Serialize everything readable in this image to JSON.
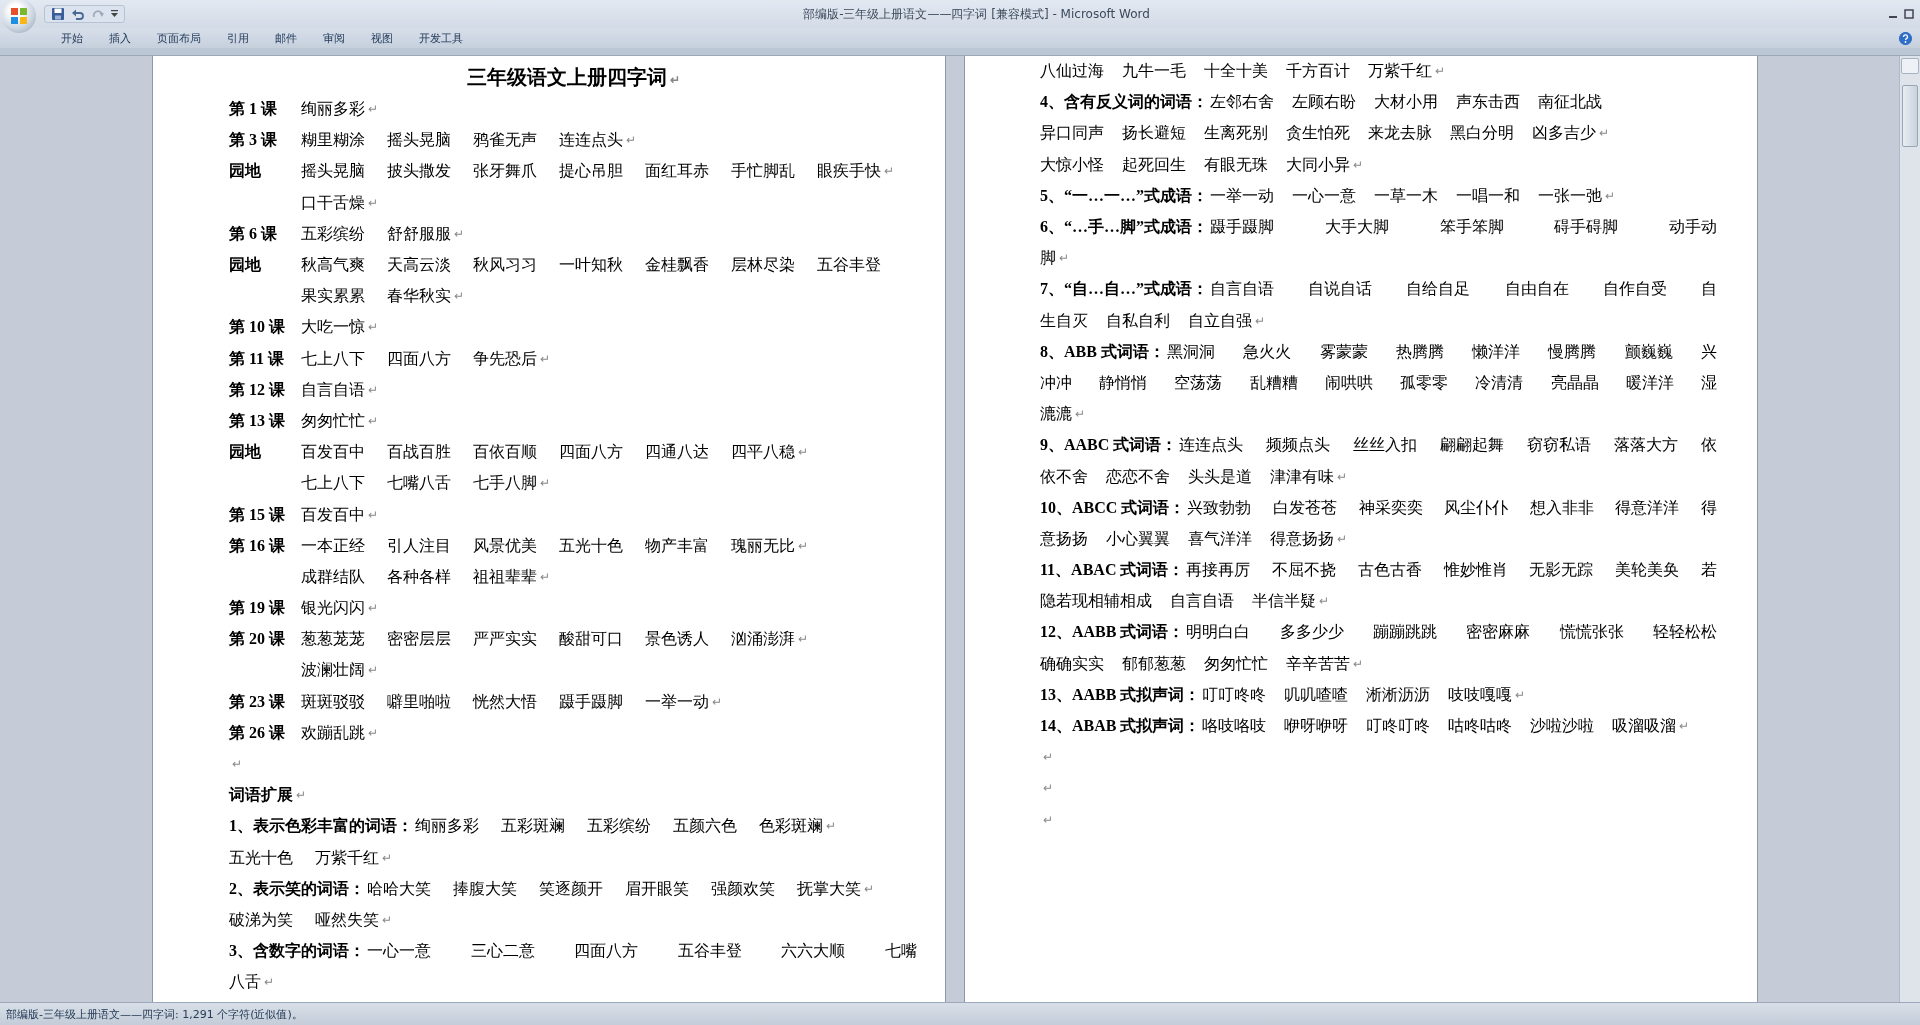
{
  "window": {
    "title": "部编版-三年级上册语文——四字词 [兼容模式] - Microsoft Word"
  },
  "ribbon_tabs": [
    {
      "label": "开始"
    },
    {
      "label": "插入"
    },
    {
      "label": "页面布局"
    },
    {
      "label": "引用"
    },
    {
      "label": "邮件"
    },
    {
      "label": "审阅"
    },
    {
      "label": "视图"
    },
    {
      "label": "开发工具"
    }
  ],
  "left_page": {
    "title": "三年级语文上册四字词",
    "end": "↵",
    "lines": [
      {
        "kind": "lesson",
        "label": "第 1 课",
        "words": [
          "绚丽多彩"
        ],
        "end": "↵"
      },
      {
        "kind": "lesson",
        "label": "第 3 课",
        "words": [
          "糊里糊涂",
          "摇头晃脑",
          "鸦雀无声",
          "连连点头"
        ],
        "end": "↵"
      },
      {
        "kind": "lesson",
        "label": "园地",
        "words": [
          "摇头晃脑",
          "披头撒发",
          "张牙舞爪",
          "提心吊胆",
          "面红耳赤",
          "手忙脚乱",
          "眼疾手快"
        ],
        "end": "↵"
      },
      {
        "kind": "continuation",
        "words": [
          "口干舌燥"
        ],
        "end": "↵"
      },
      {
        "kind": "lesson",
        "label": "第 6 课",
        "words": [
          "五彩缤纷",
          "舒舒服服"
        ],
        "end": "↵"
      },
      {
        "kind": "lesson",
        "label": "园地",
        "words": [
          "秋高气爽",
          "天高云淡",
          "秋风习习",
          "一叶知秋",
          "金桂飘香",
          "层林尽染",
          "五谷丰登"
        ]
      },
      {
        "kind": "continuation",
        "words": [
          "果实累累",
          "春华秋实"
        ],
        "end": "↵"
      },
      {
        "kind": "lesson",
        "label": "第 10 课",
        "words": [
          "大吃一惊"
        ],
        "end": "↵"
      },
      {
        "kind": "lesson",
        "label": "第 11 课",
        "words": [
          "七上八下",
          "四面八方",
          "争先恐后"
        ],
        "end": "↵"
      },
      {
        "kind": "lesson",
        "label": "第 12 课",
        "words": [
          "自言自语"
        ],
        "end": "↵"
      },
      {
        "kind": "lesson",
        "label": "第 13 课",
        "words": [
          "匆匆忙忙"
        ],
        "end": "↵"
      },
      {
        "kind": "lesson",
        "label": "园地",
        "words": [
          "百发百中",
          "百战百胜",
          "百依百顺",
          "四面八方",
          "四通八达",
          "四平八稳"
        ],
        "end": "↵"
      },
      {
        "kind": "continuation",
        "words": [
          "七上八下",
          "七嘴八舌",
          "七手八脚"
        ],
        "end": "↵"
      },
      {
        "kind": "lesson",
        "label": "第 15 课",
        "words": [
          "百发百中"
        ],
        "end": "↵"
      },
      {
        "kind": "lesson",
        "label": "第 16 课",
        "words": [
          "一本正经",
          "引人注目",
          "风景优美",
          "五光十色",
          "物产丰富",
          "瑰丽无比"
        ],
        "end": "↵"
      },
      {
        "kind": "continuation",
        "words": [
          "成群结队",
          "各种各样",
          "祖祖辈辈"
        ],
        "end": "↵"
      },
      {
        "kind": "lesson",
        "label": "第 19 课",
        "words": [
          "银光闪闪"
        ],
        "end": "↵"
      },
      {
        "kind": "lesson",
        "label": "第 20 课",
        "words": [
          "葱葱茏茏",
          "密密层层",
          "严严实实",
          "酸甜可口",
          "景色诱人",
          "汹涌澎湃"
        ],
        "end": "↵"
      },
      {
        "kind": "continuation",
        "words": [
          "波澜壮阔"
        ],
        "end": "↵"
      },
      {
        "kind": "lesson",
        "label": "第 23 课",
        "words": [
          "斑斑驳驳",
          "噼里啪啦",
          "恍然大悟",
          "蹑手蹑脚",
          "一举一动"
        ],
        "end": "↵"
      },
      {
        "kind": "lesson",
        "label": "第 26 课",
        "words": [
          "欢蹦乱跳"
        ],
        "end": "↵"
      },
      {
        "kind": "blank",
        "end": "↵"
      },
      {
        "kind": "heading",
        "label": "词语扩展",
        "end": "↵"
      },
      {
        "kind": "item",
        "label": "1、表示色彩丰富的词语：",
        "words": [
          "绚丽多彩",
          "五彩斑斓",
          "五彩缤纷",
          "五颜六色",
          "色彩斑斓"
        ],
        "end": "↵"
      },
      {
        "kind": "plain",
        "words": [
          "五光十色",
          "万紫千红"
        ],
        "end": "↵"
      },
      {
        "kind": "item",
        "label": "2、表示笑的词语：",
        "words": [
          "哈哈大笑",
          "捧腹大笑",
          "笑逐颜开",
          "眉开眼笑",
          "强颜欢笑",
          "抚掌大笑"
        ],
        "end": "↵"
      },
      {
        "kind": "plain",
        "words": [
          "破涕为笑",
          "哑然失笑"
        ],
        "end": "↵"
      },
      {
        "kind": "item",
        "label": "3、含数字的词语：",
        "words": [
          "一心一意",
          "三心二意",
          "四面八方",
          "五谷丰登",
          "六六大顺",
          "七嘴"
        ],
        "justified": true
      },
      {
        "kind": "plain",
        "words": [
          "八舌"
        ],
        "end": "↵"
      }
    ]
  },
  "right_page": {
    "lines": [
      {
        "kind": "plain",
        "words": [
          "八仙过海",
          "九牛一毛",
          "十全十美",
          "千方百计",
          "万紫千红"
        ],
        "end": "↵"
      },
      {
        "kind": "item",
        "label": "4、含有反义词的词语：",
        "words": [
          "左邻右舍",
          "左顾右盼",
          "大材小用",
          "声东击西",
          "南征北战"
        ]
      },
      {
        "kind": "plain",
        "words": [
          "异口同声",
          "扬长避短",
          "生离死别",
          "贪生怕死",
          "来龙去脉",
          "黑白分明",
          "凶多吉少"
        ],
        "end": "↵"
      },
      {
        "kind": "plain",
        "words": [
          "大惊小怪",
          "起死回生",
          "有眼无珠",
          "大同小异"
        ],
        "end": "↵"
      },
      {
        "kind": "item",
        "label": "5、“一…一…”式成语：",
        "words": [
          "一举一动",
          "一心一意",
          "一草一木",
          "一唱一和",
          "一张一弛"
        ],
        "end": "↵"
      },
      {
        "kind": "item",
        "label": "6、“…手…脚”式成语：",
        "words": [
          "蹑手蹑脚",
          "大手大脚",
          "笨手笨脚",
          "碍手碍脚",
          "动手动"
        ],
        "justified": true
      },
      {
        "kind": "plain",
        "words": [
          "脚"
        ],
        "end": "↵"
      },
      {
        "kind": "item",
        "label": "7、“自…自…”式成语：",
        "words": [
          "自言自语",
          "自说自话",
          "自给自足",
          "自由自在",
          "自作自受",
          "自"
        ],
        "justified": true
      },
      {
        "kind": "plain",
        "words": [
          "生自灭",
          "自私自利",
          "自立自强"
        ],
        "end": "↵"
      },
      {
        "kind": "item",
        "label": "8、ABB 式词语：",
        "words": [
          "黑洞洞",
          "急火火",
          "雾蒙蒙",
          "热腾腾",
          "懒洋洋",
          "慢腾腾",
          "颤巍巍",
          "兴"
        ],
        "justified": true
      },
      {
        "kind": "plain",
        "words": [
          "冲冲",
          "静悄悄",
          "空荡荡",
          "乱糟糟",
          "闹哄哄",
          "孤零零",
          "冷清清",
          "亮晶晶",
          "暖洋洋",
          "湿"
        ],
        "justified": true
      },
      {
        "kind": "plain",
        "words": [
          "漉漉"
        ],
        "end": "↵"
      },
      {
        "kind": "item",
        "label": "9、AABC 式词语：",
        "words": [
          "连连点头",
          "频频点头",
          "丝丝入扣",
          "翩翩起舞",
          "窃窃私语",
          "落落大方",
          "依"
        ],
        "justified": true
      },
      {
        "kind": "plain",
        "words": [
          "依不舍",
          "恋恋不舍",
          "头头是道",
          "津津有味"
        ],
        "end": "↵"
      },
      {
        "kind": "item",
        "label": "10、ABCC 式词语：",
        "words": [
          "兴致勃勃",
          "白发苍苍",
          "神采奕奕",
          "风尘仆仆",
          "想入非非",
          "得意洋洋",
          "得"
        ],
        "justified": true
      },
      {
        "kind": "plain",
        "words": [
          "意扬扬",
          "小心翼翼",
          "喜气洋洋",
          "得意扬扬"
        ],
        "end": "↵"
      },
      {
        "kind": "item",
        "label": "11、ABAC 式词语：",
        "words": [
          "再接再厉",
          "不屈不挠",
          "古色古香",
          "惟妙惟肖",
          "无影无踪",
          "美轮美奂",
          "若"
        ],
        "justified": true
      },
      {
        "kind": "plain",
        "words": [
          "隐若现相辅相成",
          "自言自语",
          "半信半疑"
        ],
        "end": "↵"
      },
      {
        "kind": "item",
        "label": "12、AABB 式词语：",
        "words": [
          "明明白白",
          "多多少少",
          "蹦蹦跳跳",
          "密密麻麻",
          "慌慌张张",
          "轻轻松松"
        ],
        "justified": true
      },
      {
        "kind": "plain",
        "words": [
          "确确实实",
          "郁郁葱葱",
          "匆匆忙忙",
          "辛辛苦苦"
        ],
        "end": "↵"
      },
      {
        "kind": "item",
        "label": "13、AABB 式拟声词：",
        "words": [
          "叮叮咚咚",
          "叽叽喳喳",
          "淅淅沥沥",
          "吱吱嘎嘎"
        ],
        "end": "↵"
      },
      {
        "kind": "item",
        "label": "14、ABAB 式拟声词：",
        "words": [
          "咯吱咯吱",
          "咿呀咿呀",
          "叮咚叮咚",
          "咕咚咕咚",
          "沙啦沙啦",
          "吸溜吸溜"
        ],
        "end": "↵"
      },
      {
        "kind": "blank",
        "end": "↵"
      },
      {
        "kind": "blank",
        "end": "↵"
      },
      {
        "kind": "blank",
        "end": "↵"
      }
    ]
  },
  "status_bar": {
    "text": "部编版-三年级上册语文——四字词: 1,291 个字符(近似值)。"
  }
}
